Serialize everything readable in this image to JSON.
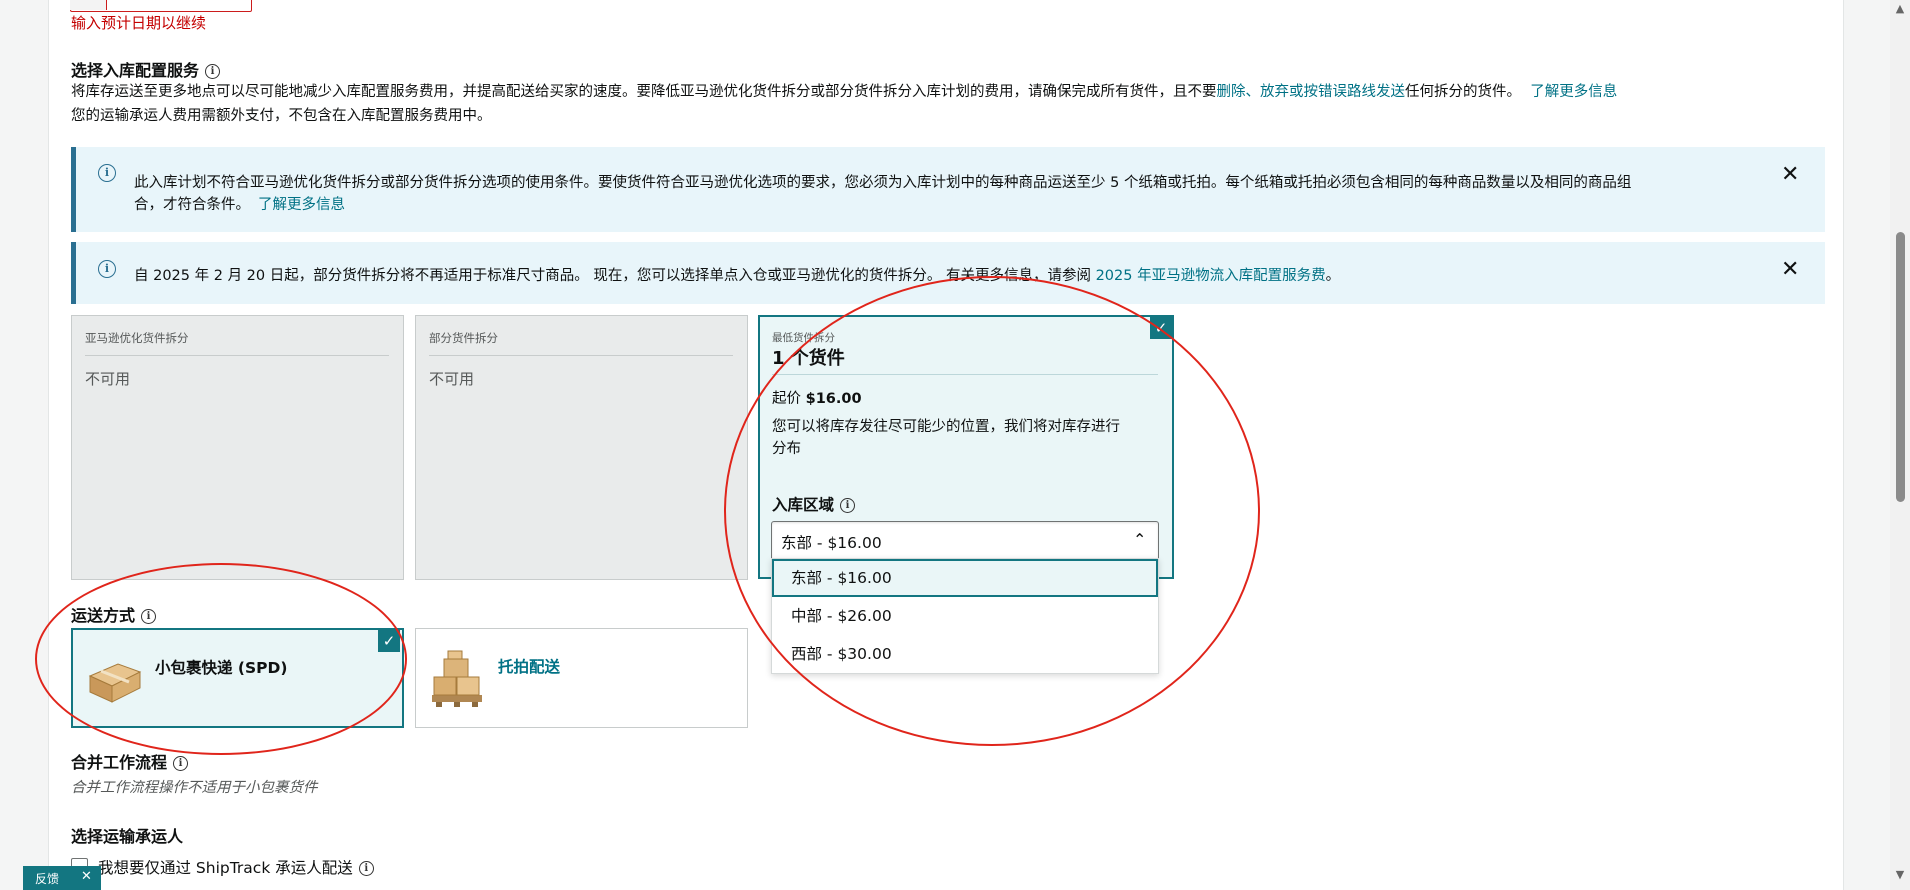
{
  "date_error": "输入预计日期以继续",
  "placement": {
    "title": "选择入库配置服务",
    "desc_line1_a": "将库存运送至更多地点可以尽可能地减少入库配置服务费用，并提高配送给买家的速度。要降低亚马逊优化货件拆分或部分货件拆分入库计划的费用，请确保完成所有货件，且不要",
    "desc_line1_link": "删除、放弃或按错误路线发送",
    "desc_line1_b": "任何拆分的货件。",
    "learn_more": "了解更多信息",
    "desc_line2": "您的运输承运人费用需额外支付，不包含在入库配置服务费用中。"
  },
  "alerts": [
    {
      "text_line1": "此入库计划不符合亚马逊优化货件拆分或部分货件拆分选项的使用条件。要使货件符合亚马逊优化选项的要求，您必须为入库计划中的每种商品运送至少 5 个纸箱或托拍。每个纸箱或托拍必须包含相同的每种商品数量以及相同的商品组",
      "text_line2": "合，才符合条件。",
      "link": "了解更多信息"
    },
    {
      "text": "自 2025 年 2 月 20 日起，部分货件拆分将不再适用于标准尺寸商品。 现在，您可以选择单点入仓或亚马逊优化的货件拆分。 有关更多信息，请参阅 ",
      "link": "2025 年亚马逊物流入库配置服务费",
      "suffix": "。"
    }
  ],
  "options": [
    {
      "label": "亚马逊优化货件拆分",
      "status": "不可用"
    },
    {
      "label": "部分货件拆分",
      "status": "不可用"
    }
  ],
  "min_split": {
    "label": "最低货件拆分",
    "title": "1 个货件",
    "price_prefix": "起价 ",
    "price": "$16.00",
    "desc_line1": "您可以将库存发往尽可能少的位置，我们将对库存进行",
    "desc_line2": "分布",
    "region_label": "入库区域",
    "selected": "东部 - $16.00",
    "dropdown": [
      "东部 - $16.00",
      "中部 - $26.00",
      "西部 - $30.00"
    ]
  },
  "shipping": {
    "title": "运送方式",
    "spd": "小包裹快递 (SPD)",
    "ltl": "托拍配送"
  },
  "workflow": {
    "title": "合并工作流程",
    "note": "合并工作流程操作不适用于小包裹货件"
  },
  "carrier": {
    "title": "选择运输承运人",
    "checkbox_label": "我想要仅通过 ShipTrack 承运人配送"
  },
  "feedback": {
    "label": "反馈"
  },
  "colors": {
    "teal": "#137681",
    "link": "#007185",
    "error": "#c40000",
    "annotation": "#e0251b"
  }
}
